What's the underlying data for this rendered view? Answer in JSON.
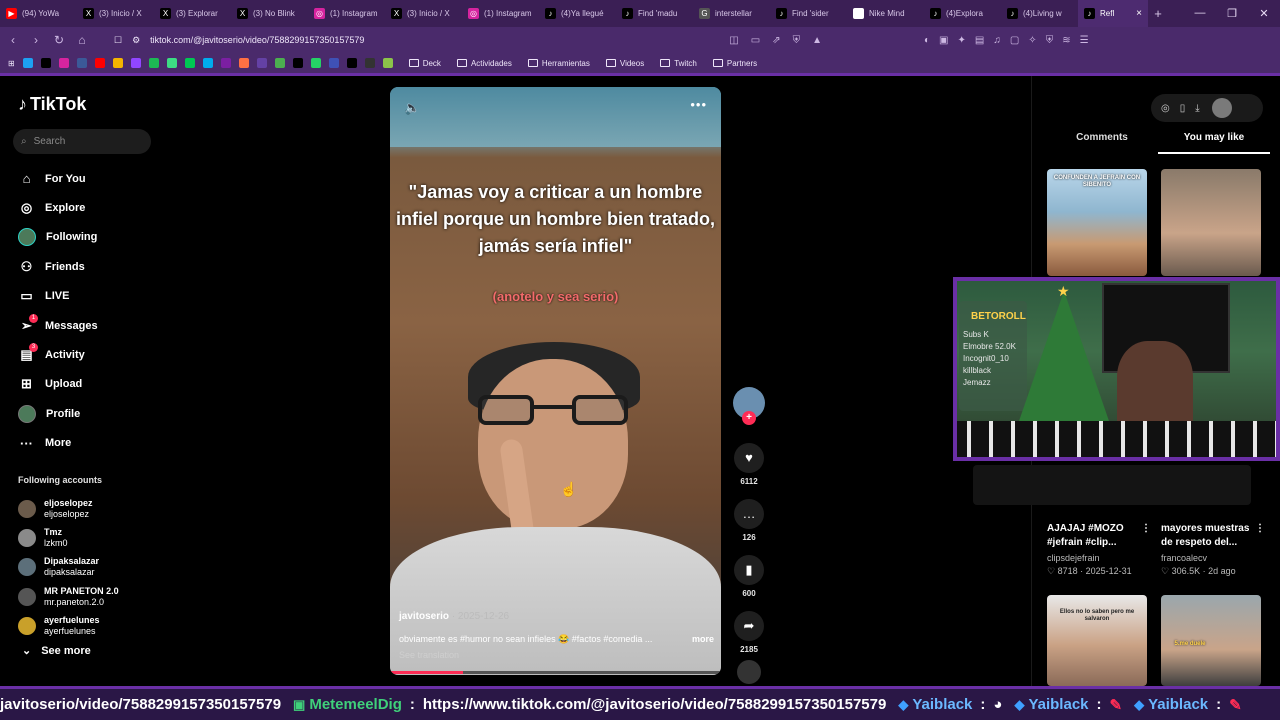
{
  "browser": {
    "tabs": [
      {
        "title": "(94) YoWa",
        "fav_color": "#ff0000",
        "fav_glyph": "▶"
      },
      {
        "title": "(3) Inicio / X",
        "fav_color": "#000000",
        "fav_glyph": "X"
      },
      {
        "title": "(3) Explorar",
        "fav_color": "#000000",
        "fav_glyph": "X"
      },
      {
        "title": "(3) No Blink",
        "fav_color": "#000000",
        "fav_glyph": "X"
      },
      {
        "title": "(1) Instagram",
        "fav_color": "#d6249f",
        "fav_glyph": "◎"
      },
      {
        "title": "(3) Inicio / X",
        "fav_color": "#000000",
        "fav_glyph": "X"
      },
      {
        "title": "(1) Instagram",
        "fav_color": "#d6249f",
        "fav_glyph": "◎"
      },
      {
        "title": "(4)Ya llegué",
        "fav_color": "#000000",
        "fav_glyph": "♪"
      },
      {
        "title": "Find 'madu",
        "fav_color": "#000000",
        "fav_glyph": "♪"
      },
      {
        "title": "interstellar",
        "fav_color": "#555555",
        "fav_glyph": "G"
      },
      {
        "title": "Find 'sider",
        "fav_color": "#000000",
        "fav_glyph": "♪"
      },
      {
        "title": "Nike Mind",
        "fav_color": "#ffffff",
        "fav_glyph": "✓"
      },
      {
        "title": "(4)Explora",
        "fav_color": "#000000",
        "fav_glyph": "♪"
      },
      {
        "title": "(4)Living w",
        "fav_color": "#000000",
        "fav_glyph": "♪"
      },
      {
        "title": "Refl",
        "fav_color": "#000000",
        "fav_glyph": "♪",
        "active": true
      }
    ],
    "url": "tiktok.com/@javitoserio/video/7588299157350157579",
    "bookmarks": {
      "folders": [
        "Deck",
        "Actividades",
        "Herramientas",
        "Videos",
        "Twitch",
        "Partners"
      ],
      "icon_colors": [
        "#1da1f2",
        "#000000",
        "#d6249f",
        "#3b5998",
        "#ff0000",
        "#f4b400",
        "#9146ff",
        "#1db954",
        "#3ddc84",
        "#00c853",
        "#00acee",
        "#7b1fa2",
        "#ff7043",
        "#6441a5",
        "#4caf50",
        "#000000",
        "#25d366",
        "#3f51b5",
        "#000000",
        "#333333",
        "#8bc34a"
      ]
    }
  },
  "sidebar": {
    "brand": "TikTok",
    "search_placeholder": "Search",
    "menu": [
      {
        "label": "For You",
        "icon": "home-icon"
      },
      {
        "label": "Explore",
        "icon": "compass-icon"
      },
      {
        "label": "Following",
        "icon": "following-avatar"
      },
      {
        "label": "Friends",
        "icon": "friends-icon"
      },
      {
        "label": "LIVE",
        "icon": "live-icon"
      },
      {
        "label": "Messages",
        "icon": "paper-plane-icon",
        "badge": "1"
      },
      {
        "label": "Activity",
        "icon": "inbox-icon",
        "badge": "3"
      },
      {
        "label": "Upload",
        "icon": "plus-square-icon"
      },
      {
        "label": "Profile",
        "icon": "profile-avatar"
      },
      {
        "label": "More",
        "icon": "ellipsis-icon"
      }
    ],
    "following_title": "Following accounts",
    "accounts": [
      {
        "name": "eljoselopez",
        "handle": "eljoselopez"
      },
      {
        "name": "Tmz",
        "handle": "lzkm0"
      },
      {
        "name": "Dipaksalazar",
        "handle": "dipaksalazar"
      },
      {
        "name": "MR PANETON 2.0",
        "handle": "mr.paneton.2.0"
      },
      {
        "name": "ayerfuelunes",
        "handle": "ayerfuelunes"
      }
    ],
    "see_more": "See more"
  },
  "video": {
    "caption": "\"Jamas voy a criticar a un hombre infiel porque un hombre bien tratado, jamás sería infiel\"",
    "subcaption": "(anotelo y sea serio)",
    "author": "javitoserio",
    "date": "· 2025-12-26",
    "description": "obviamente es #humor no sean infieles 😂 #factos #comedia ...",
    "more": "more",
    "see_translation": "See translation",
    "progress": 0.22
  },
  "actions": {
    "likes": "6112",
    "comments": "126",
    "saves": "600",
    "shares": "2185"
  },
  "right_panel": {
    "tabs": [
      "Comments",
      "You may like"
    ],
    "active_tab": "You may like",
    "thumb_texts": [
      "CONFUNDEN A JEFRAIN CON SIBENITO",
      "Ellos no lo saben pero me salvaron",
      "5.me duele"
    ],
    "cards": [
      {
        "title": "AJAJAJ #MOZO #jefrain #clip...",
        "user": "clipsdejefrain",
        "likes": "♡ 8718",
        "date": "· 2025-12-31"
      },
      {
        "title": "mayores muestras de respeto del...",
        "user": "francoalecv",
        "likes": "♡ 306.5K",
        "date": "· 2d ago"
      }
    ]
  },
  "stream_overlay": {
    "brand": "BETOROLL",
    "lines": [
      "Subs K",
      "Elmobre 52.0K",
      "Incognit0_10",
      "killblack",
      "Jemazz"
    ]
  },
  "ticker": {
    "leading_url": "javitoserio/video/7588299157350157579",
    "user": "MetemeelDig",
    "url": "https://www.tiktok.com/@javitoserio/video/7588299157350157579",
    "user2": "Yaiblack",
    "colon": ":"
  }
}
